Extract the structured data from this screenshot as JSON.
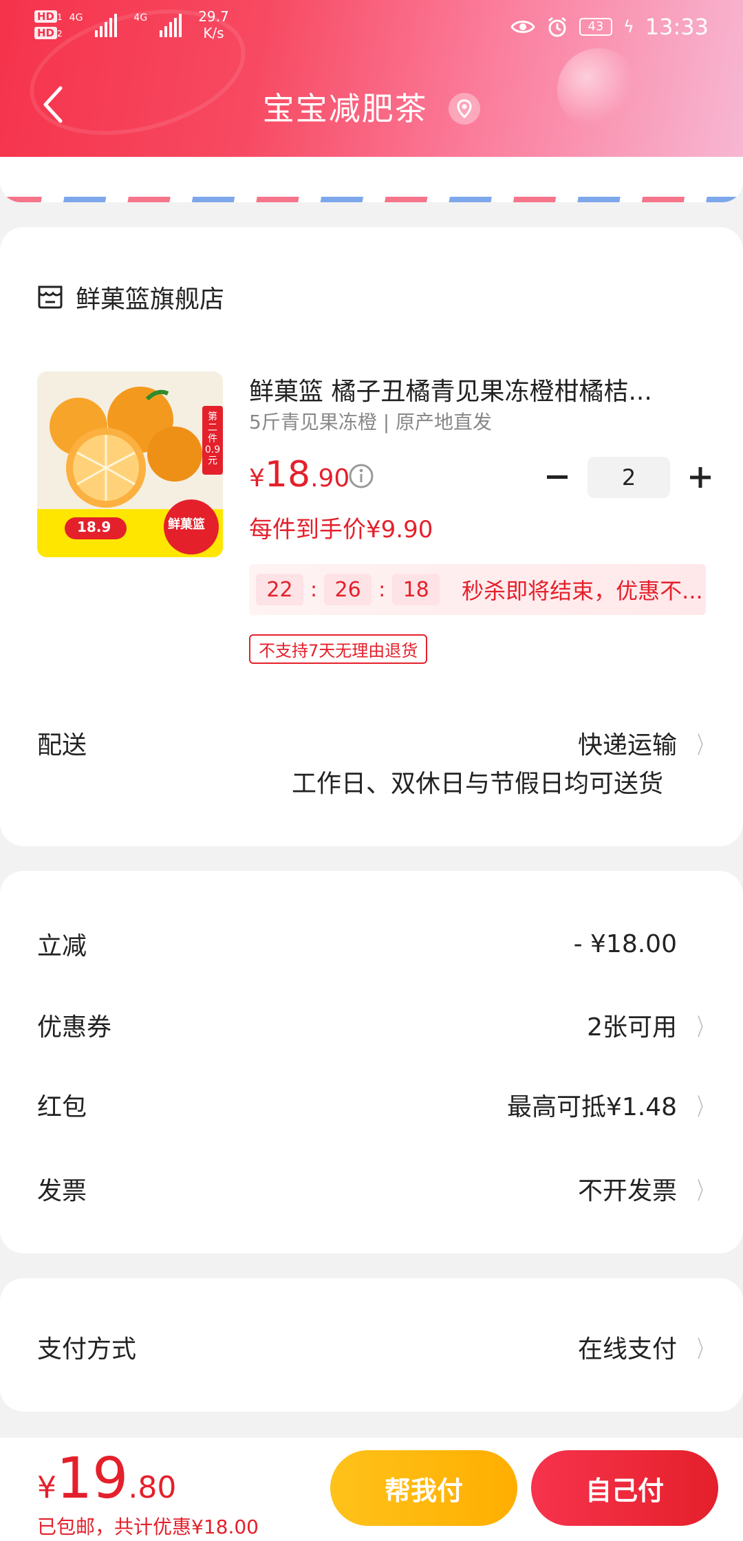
{
  "status_bar": {
    "hd_top": "HD",
    "hd_sub_top": "1",
    "hd_bottom": "HD",
    "hd_sub_bottom": "2",
    "net1": "4G",
    "net2": "4G",
    "speed_value": "29.7",
    "speed_unit": "K/s",
    "battery": "43",
    "time": "13:33"
  },
  "header": {
    "title": "宝宝减肥茶"
  },
  "store": {
    "name": "鲜菓篮旗舰店"
  },
  "product": {
    "title": "鲜菓篮 橘子丑橘青见果冻橙柑橘桔...",
    "spec": "5斤青见果冻橙 | 原产地直发",
    "price_symbol": "¥",
    "price_int": "18",
    "price_dec": ".90",
    "quantity": "2",
    "unit_price": "每件到手价¥9.90",
    "timer_h": "22",
    "timer_m": "26",
    "timer_s": "18",
    "flash_msg": "秒杀即将结束，优惠不...",
    "no_return": "不支持7天无理由退货",
    "thumb_price": "18.9",
    "thumb_badge": "鲜菓篮",
    "thumb_promo": "第二件0.9元"
  },
  "delivery": {
    "label": "配送",
    "method": "快递运输",
    "note": "工作日、双休日与节假日均可送货"
  },
  "discounts": {
    "instant_label": "立减",
    "instant_value": "- ¥18.00",
    "coupon_label": "优惠券",
    "coupon_value": "2张可用",
    "redpack_label": "红包",
    "redpack_value": "最高可抵¥1.48",
    "invoice_label": "发票",
    "invoice_value": "不开发票"
  },
  "payment": {
    "label": "支付方式",
    "value": "在线支付"
  },
  "footer": {
    "symbol": "¥",
    "total_int": "19",
    "total_dec": ".80",
    "summary": "已包邮，共计优惠¥18.00",
    "help_pay": "帮我付",
    "self_pay": "自己付"
  },
  "colors": {
    "accent_red": "#e4202b",
    "help_yellow": "#ffb400",
    "header_pink": "#f5334b"
  }
}
